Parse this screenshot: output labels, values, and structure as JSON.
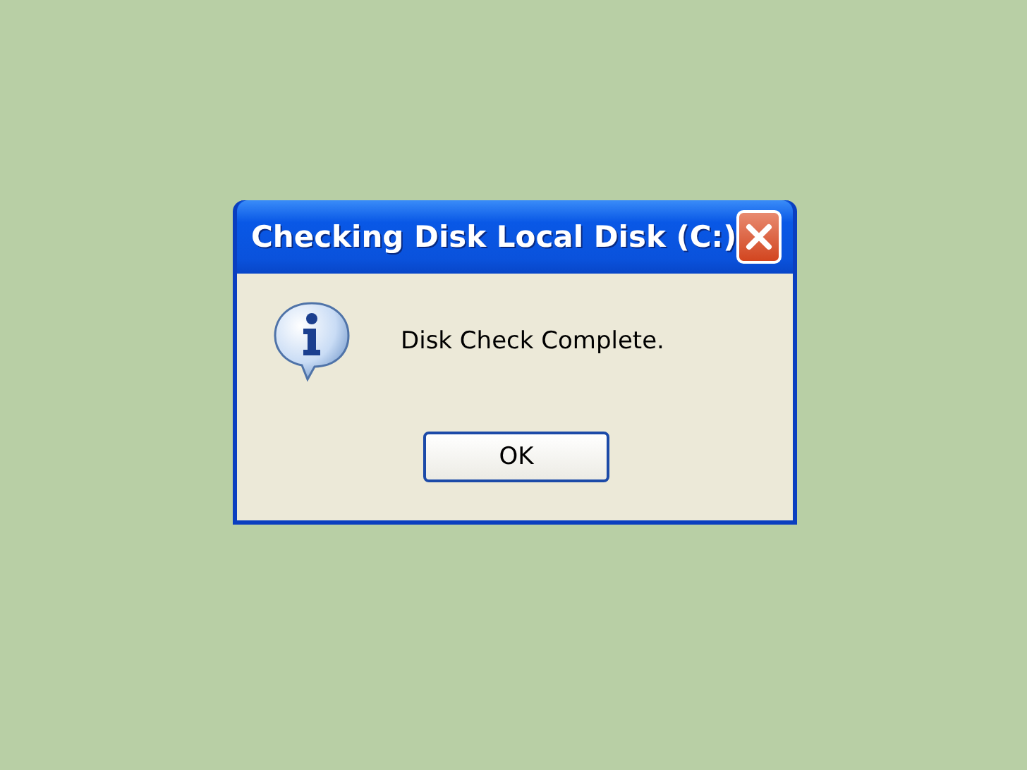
{
  "window": {
    "title": "Checking Disk Local Disk (C:)"
  },
  "message": "Disk Check Complete.",
  "buttons": [
    "OK"
  ]
}
